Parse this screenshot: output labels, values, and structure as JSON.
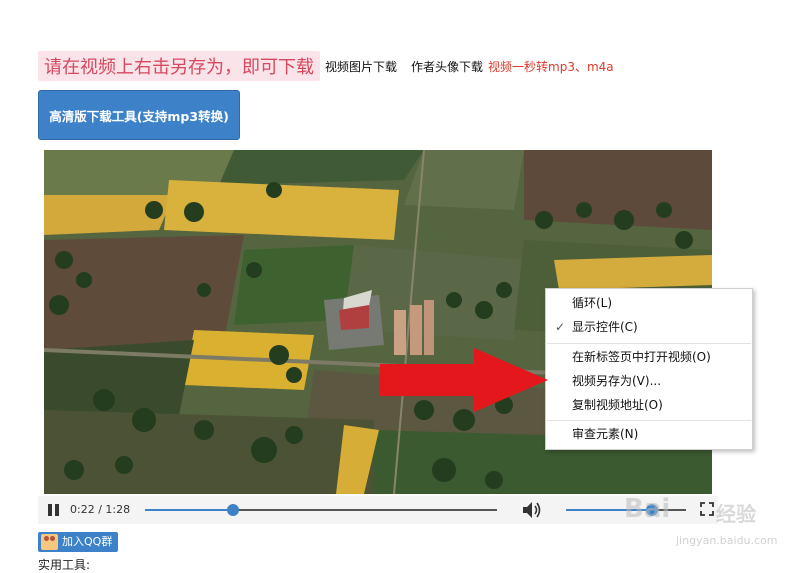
{
  "header": {
    "instruction": "请在视频上右击另存为，即可下载",
    "links": [
      "视频图片下载",
      "作者头像下载",
      "视频一秒转mp3、m4a"
    ]
  },
  "download_tool_label": "高清版下载工具(支持mp3转换)",
  "context_menu": {
    "items": [
      {
        "label": "循环(L)",
        "checked": false
      },
      {
        "label": "显示控件(C)",
        "checked": true
      },
      {
        "label": "在新标签页中打开视频(O)",
        "checked": false
      },
      {
        "label": "视频另存为(V)...",
        "checked": false
      },
      {
        "label": "复制视频地址(O)",
        "checked": false
      },
      {
        "label": "审查元素(N)",
        "checked": false
      }
    ]
  },
  "player": {
    "time": "0:22 / 1:28",
    "progress_fraction": 0.25,
    "volume_fraction": 0.72
  },
  "footer": {
    "qq_button": "加入QQ群",
    "tools_label": "实用工具:"
  },
  "watermark": {
    "brand_a": "Bai",
    "brand_b": "经验",
    "url": "jingyan.baidu.com"
  },
  "colors": {
    "accent": "#3d82c8",
    "instruction_bg": "#fbe3ea",
    "instruction_text": "#d6495e",
    "link_red": "#e0392b",
    "arrow_red": "#e4171c"
  },
  "icons": [
    "pause-icon",
    "volume-icon",
    "fullscreen-icon",
    "checkmark-icon",
    "qq-group-icon",
    "red-arrow-icon"
  ]
}
